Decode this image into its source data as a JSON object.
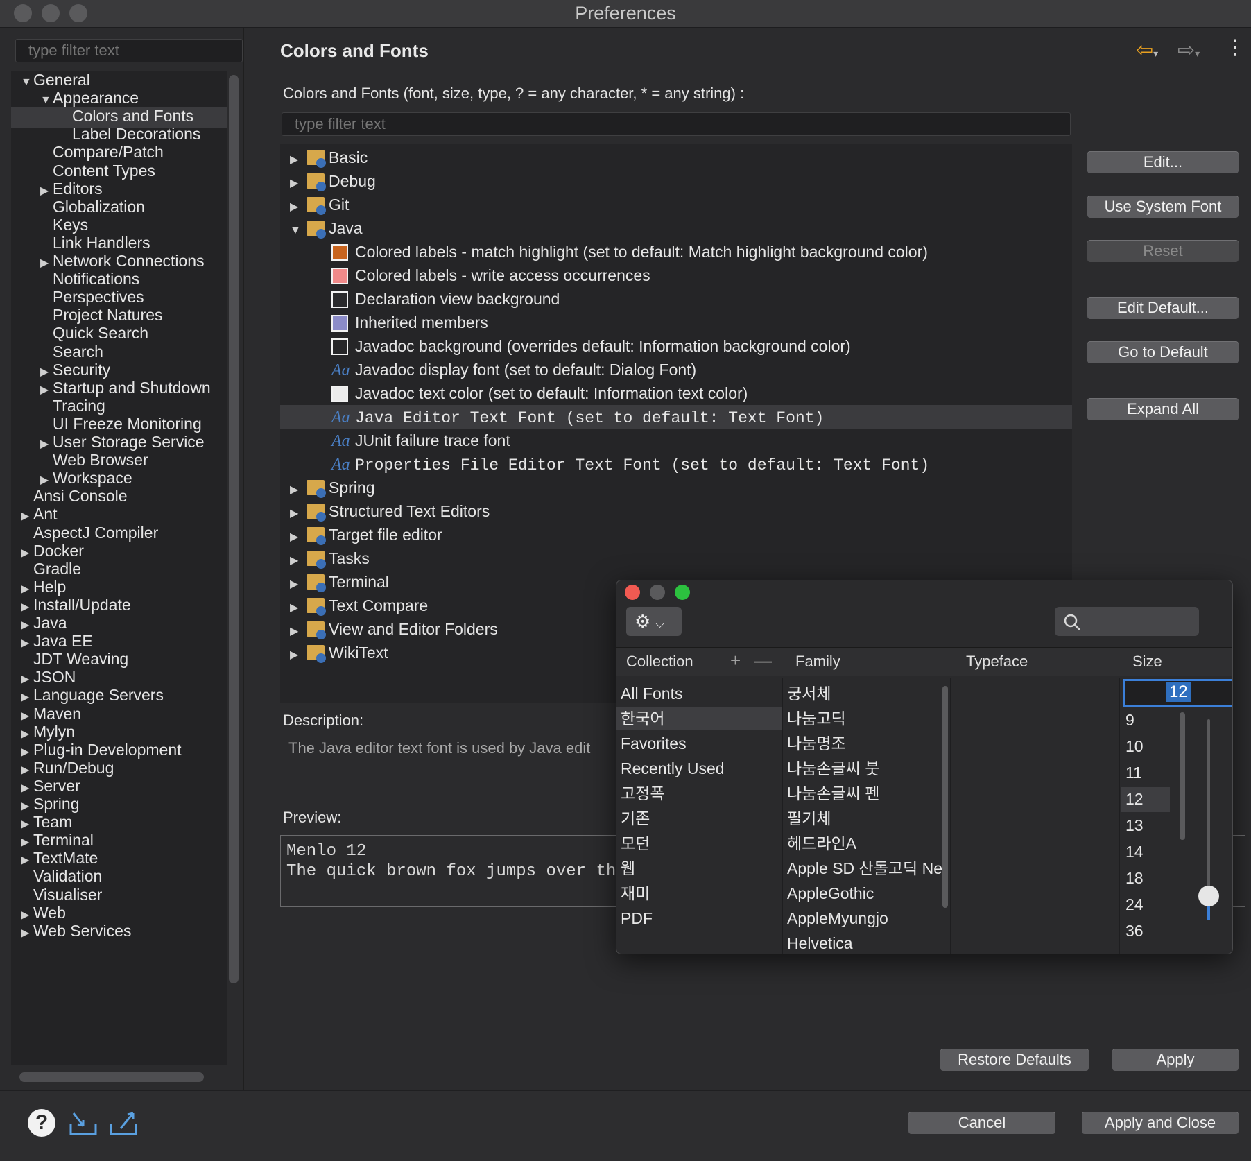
{
  "window": {
    "title": "Preferences"
  },
  "left": {
    "filter_placeholder": "type filter text",
    "tree": [
      {
        "label": "General",
        "level": 0,
        "arrow": "down"
      },
      {
        "label": "Appearance",
        "level": 1,
        "arrow": "down"
      },
      {
        "label": "Colors and Fonts",
        "level": 2,
        "arrow": "",
        "selected": true
      },
      {
        "label": "Label Decorations",
        "level": 2,
        "arrow": ""
      },
      {
        "label": "Compare/Patch",
        "level": 1,
        "arrow": ""
      },
      {
        "label": "Content Types",
        "level": 1,
        "arrow": ""
      },
      {
        "label": "Editors",
        "level": 1,
        "arrow": "right"
      },
      {
        "label": "Globalization",
        "level": 1,
        "arrow": ""
      },
      {
        "label": "Keys",
        "level": 1,
        "arrow": ""
      },
      {
        "label": "Link Handlers",
        "level": 1,
        "arrow": ""
      },
      {
        "label": "Network Connections",
        "level": 1,
        "arrow": "right"
      },
      {
        "label": "Notifications",
        "level": 1,
        "arrow": ""
      },
      {
        "label": "Perspectives",
        "level": 1,
        "arrow": ""
      },
      {
        "label": "Project Natures",
        "level": 1,
        "arrow": ""
      },
      {
        "label": "Quick Search",
        "level": 1,
        "arrow": ""
      },
      {
        "label": "Search",
        "level": 1,
        "arrow": ""
      },
      {
        "label": "Security",
        "level": 1,
        "arrow": "right"
      },
      {
        "label": "Startup and Shutdown",
        "level": 1,
        "arrow": "right"
      },
      {
        "label": "Tracing",
        "level": 1,
        "arrow": ""
      },
      {
        "label": "UI Freeze Monitoring",
        "level": 1,
        "arrow": ""
      },
      {
        "label": "User Storage Service",
        "level": 1,
        "arrow": "right"
      },
      {
        "label": "Web Browser",
        "level": 1,
        "arrow": ""
      },
      {
        "label": "Workspace",
        "level": 1,
        "arrow": "right"
      },
      {
        "label": "Ansi Console",
        "level": 0,
        "arrow": ""
      },
      {
        "label": "Ant",
        "level": 0,
        "arrow": "right"
      },
      {
        "label": "AspectJ Compiler",
        "level": 0,
        "arrow": ""
      },
      {
        "label": "Docker",
        "level": 0,
        "arrow": "right"
      },
      {
        "label": "Gradle",
        "level": 0,
        "arrow": ""
      },
      {
        "label": "Help",
        "level": 0,
        "arrow": "right"
      },
      {
        "label": "Install/Update",
        "level": 0,
        "arrow": "right"
      },
      {
        "label": "Java",
        "level": 0,
        "arrow": "right"
      },
      {
        "label": "Java EE",
        "level": 0,
        "arrow": "right"
      },
      {
        "label": "JDT Weaving",
        "level": 0,
        "arrow": ""
      },
      {
        "label": "JSON",
        "level": 0,
        "arrow": "right"
      },
      {
        "label": "Language Servers",
        "level": 0,
        "arrow": "right"
      },
      {
        "label": "Maven",
        "level": 0,
        "arrow": "right"
      },
      {
        "label": "Mylyn",
        "level": 0,
        "arrow": "right"
      },
      {
        "label": "Plug-in Development",
        "level": 0,
        "arrow": "right"
      },
      {
        "label": "Run/Debug",
        "level": 0,
        "arrow": "right"
      },
      {
        "label": "Server",
        "level": 0,
        "arrow": "right"
      },
      {
        "label": "Spring",
        "level": 0,
        "arrow": "right"
      },
      {
        "label": "Team",
        "level": 0,
        "arrow": "right"
      },
      {
        "label": "Terminal",
        "level": 0,
        "arrow": "right"
      },
      {
        "label": "TextMate",
        "level": 0,
        "arrow": "right"
      },
      {
        "label": "Validation",
        "level": 0,
        "arrow": ""
      },
      {
        "label": "Visualiser",
        "level": 0,
        "arrow": ""
      },
      {
        "label": "Web",
        "level": 0,
        "arrow": "right"
      },
      {
        "label": "Web Services",
        "level": 0,
        "arrow": "right"
      }
    ]
  },
  "main": {
    "title": "Colors and Fonts",
    "description_line": "Colors and Fonts (font, size, type, ? = any character, * = any string) :",
    "filter_placeholder": "type filter text",
    "tree": [
      {
        "kind": "folder",
        "label": "Basic",
        "arrow": "right"
      },
      {
        "kind": "folder",
        "label": "Debug",
        "arrow": "right"
      },
      {
        "kind": "folder",
        "label": "Git",
        "arrow": "right"
      },
      {
        "kind": "folder",
        "label": "Java",
        "arrow": "down"
      },
      {
        "kind": "color",
        "label": "Colored labels - match highlight (set to default: Match highlight background color)",
        "color": "#c8641e"
      },
      {
        "kind": "color",
        "label": "Colored labels - write access occurrences",
        "color": "#f08a8a"
      },
      {
        "kind": "color",
        "label": "Declaration view background",
        "color": "#2a2a2c"
      },
      {
        "kind": "color",
        "label": "Inherited members",
        "color": "#8c8cc8"
      },
      {
        "kind": "color",
        "label": "Javadoc background (overrides default: Information background color)",
        "color": "#262628"
      },
      {
        "kind": "font",
        "label": "Javadoc display font (set to default: Dialog Font)",
        "mono": false
      },
      {
        "kind": "color",
        "label": "Javadoc text color (set to default: Information text color)",
        "color": "#ececec"
      },
      {
        "kind": "font",
        "label": "Java Editor Text Font (set to default: Text Font)",
        "mono": true,
        "selected": true
      },
      {
        "kind": "font",
        "label": "JUnit failure trace font",
        "mono": false
      },
      {
        "kind": "font",
        "label": "Properties File Editor Text Font (set to default: Text Font)",
        "mono": true
      },
      {
        "kind": "folder",
        "label": "Spring",
        "arrow": "right"
      },
      {
        "kind": "folder",
        "label": "Structured Text Editors",
        "arrow": "right"
      },
      {
        "kind": "folder",
        "label": "Target file editor",
        "arrow": "right"
      },
      {
        "kind": "folder",
        "label": "Tasks",
        "arrow": "right"
      },
      {
        "kind": "folder",
        "label": "Terminal",
        "arrow": "right"
      },
      {
        "kind": "folder",
        "label": "Text Compare",
        "arrow": "right"
      },
      {
        "kind": "folder",
        "label": "View and Editor Folders",
        "arrow": "right"
      },
      {
        "kind": "folder",
        "label": "WikiText",
        "arrow": "right"
      }
    ],
    "buttons": {
      "edit": "Edit...",
      "use_system_font": "Use System Font",
      "reset": "Reset",
      "edit_default": "Edit Default...",
      "go_to_default": "Go to Default",
      "expand_all": "Expand All"
    },
    "description_label": "Description:",
    "description_text": "The Java editor text font is used by Java edit",
    "preview_label": "Preview:",
    "preview_line1": "Menlo 12",
    "preview_line2": "The quick brown fox jumps over th",
    "restore_defaults": "Restore Defaults",
    "apply": "Apply"
  },
  "footer": {
    "cancel": "Cancel",
    "apply_and_close": "Apply and Close"
  },
  "font_panel": {
    "headers": {
      "collection": "Collection",
      "family": "Family",
      "typeface": "Typeface",
      "size": "Size"
    },
    "collections": [
      "All Fonts",
      "한국어",
      "Favorites",
      "Recently Used",
      "고정폭",
      "기존",
      "모던",
      "웹",
      "재미",
      "PDF"
    ],
    "selected_collection": "한국어",
    "families": [
      "궁서체",
      "나눔고딕",
      "나눔명조",
      "나눔손글씨 붓",
      "나눔손글씨 펜",
      "필기체",
      "헤드라인A",
      "Apple SD 산돌고딕 Neo",
      "AppleGothic",
      "AppleMyungjo",
      "Helvetica"
    ],
    "size_value": "12",
    "sizes": [
      "9",
      "10",
      "11",
      "12",
      "13",
      "14",
      "18",
      "24",
      "36"
    ],
    "selected_size": "12",
    "size_slider_fraction": 0.12
  }
}
